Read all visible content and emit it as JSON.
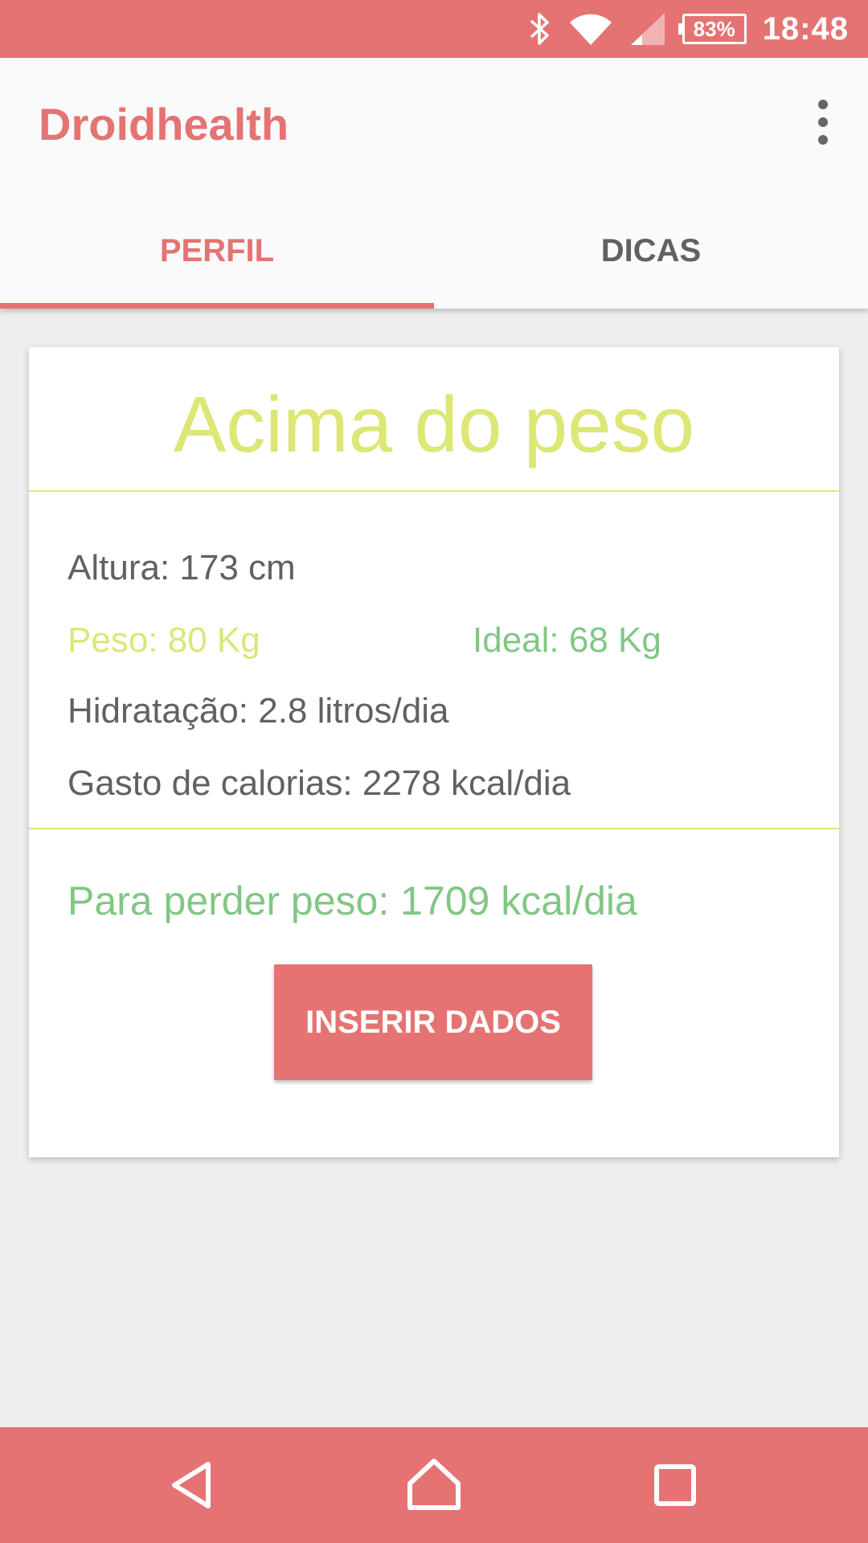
{
  "status_bar": {
    "battery": "83%",
    "time": "18:48",
    "icons": [
      "bluetooth-icon",
      "wifi-icon",
      "cell-signal-icon",
      "battery-icon"
    ]
  },
  "app_bar": {
    "title": "Droidhealth",
    "menu_icon": "more-vert-icon"
  },
  "tabs": [
    {
      "label": "PERFIL",
      "active": true
    },
    {
      "label": "DICAS",
      "active": false
    }
  ],
  "profile": {
    "status": "Acima do peso",
    "height": "Altura: 173 cm",
    "weight": "Peso: 80 Kg",
    "ideal": "Ideal: 68 Kg",
    "hydration": "Hidratação: 2.8 litros/dia",
    "calories": "Gasto de calorias: 2278 kcal/dia",
    "lose_weight": "Para perder peso: 1709 kcal/dia",
    "button_label": "INSERIR DADOS"
  },
  "nav_bar": {
    "icons": [
      "back-icon",
      "home-icon",
      "recents-icon"
    ]
  },
  "colors": {
    "primary": "#e57373",
    "status_overweight": "#dce775",
    "ideal_green": "#81c784",
    "text_grey": "#616161",
    "background": "#eeeeee"
  }
}
